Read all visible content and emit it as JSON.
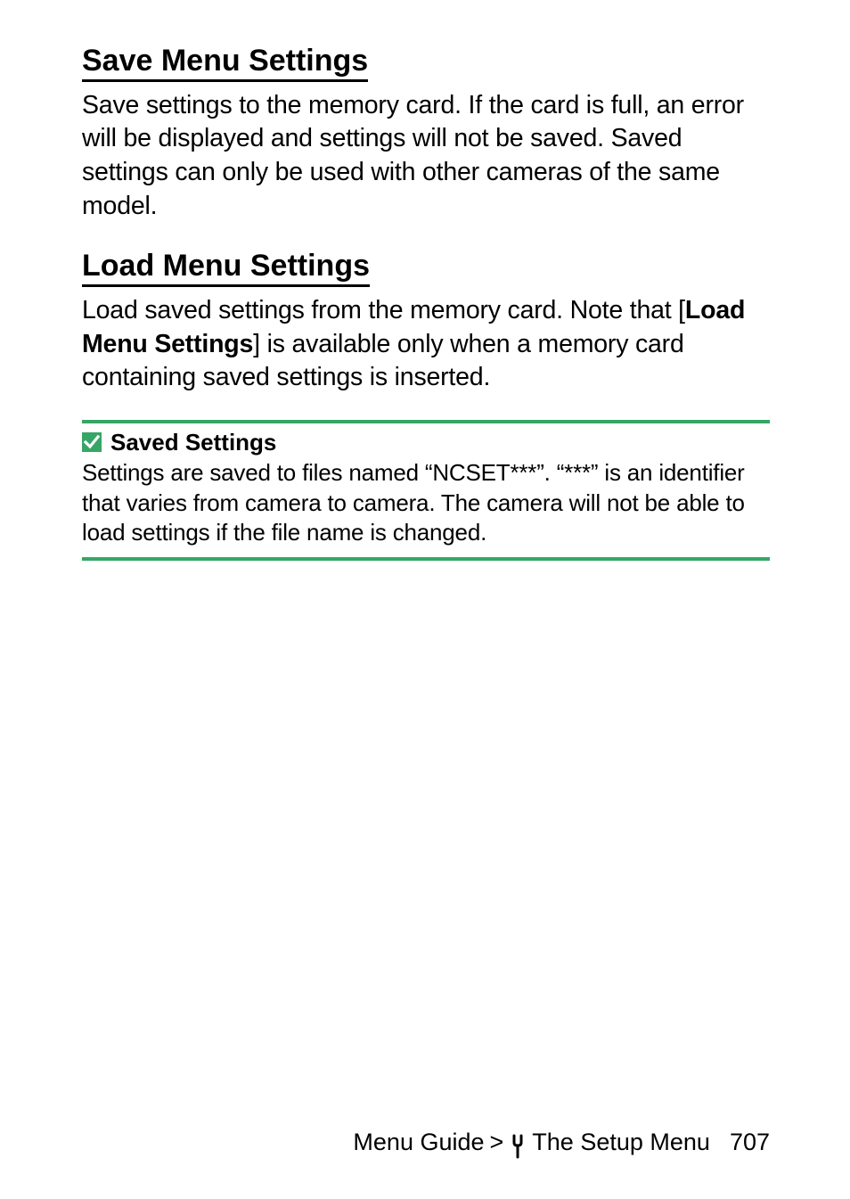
{
  "sections": {
    "save": {
      "heading": "Save Menu Settings",
      "body": "Save settings to the memory card. If the card is full, an error will be displayed and settings will not be saved. Saved settings can only be used with other cameras of the same model."
    },
    "load": {
      "heading": "Load Menu Settings",
      "body_pre": "Load saved settings from the memory card. Note that [",
      "body_bold": "Load Menu Settings",
      "body_post": "] is available only when a memory card containing saved settings is inserted."
    }
  },
  "note": {
    "title": "Saved Settings",
    "body": "Settings are saved to files named “NCSET***”. “***” is an identifier that varies from camera to camera. The camera will not be able to load settings if the file name is changed."
  },
  "footer": {
    "breadcrumb_left": "Menu Guide",
    "separator": ">",
    "breadcrumb_right": "The Setup Menu",
    "page_number": "707"
  }
}
